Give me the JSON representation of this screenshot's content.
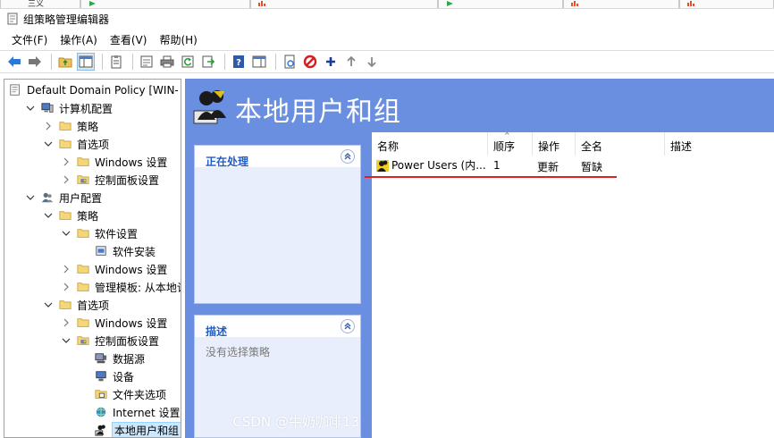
{
  "window": {
    "title": "组策略管理编辑器"
  },
  "tabstrip": {
    "fragment_label": "三义"
  },
  "menu": {
    "items": [
      "文件(F)",
      "操作(A)",
      "查看(V)",
      "帮助(H)"
    ]
  },
  "toolbar": {
    "buttons": [
      "back-icon",
      "forward-icon",
      "up-folder-icon",
      "show-hide-tree-icon",
      "clipboard-icon",
      "properties-icon",
      "print-icon",
      "refresh-icon",
      "export-icon",
      "help-icon",
      "show-hide-action-pane-icon",
      "new-icon",
      "stop-icon",
      "add-icon",
      "move-up-icon",
      "move-down-icon"
    ]
  },
  "tree": {
    "items": [
      {
        "label": "Default Domain Policy [WIN-",
        "depth": 0,
        "expanded": null,
        "icon": "policy-doc-icon"
      },
      {
        "label": "计算机配置",
        "depth": 1,
        "expanded": true,
        "icon": "computer-icon"
      },
      {
        "label": "策略",
        "depth": 2,
        "expanded": false,
        "icon": "folder-icon"
      },
      {
        "label": "首选项",
        "depth": 2,
        "expanded": true,
        "icon": "folder-icon"
      },
      {
        "label": "Windows 设置",
        "depth": 3,
        "expanded": false,
        "icon": "folder-icon"
      },
      {
        "label": "控制面板设置",
        "depth": 3,
        "expanded": false,
        "icon": "control-panel-folder-icon"
      },
      {
        "label": "用户配置",
        "depth": 1,
        "expanded": true,
        "icon": "users-icon"
      },
      {
        "label": "策略",
        "depth": 2,
        "expanded": true,
        "icon": "folder-icon"
      },
      {
        "label": "软件设置",
        "depth": 3,
        "expanded": true,
        "icon": "folder-icon"
      },
      {
        "label": "软件安装",
        "depth": 4,
        "expanded": null,
        "icon": "software-install-icon"
      },
      {
        "label": "Windows 设置",
        "depth": 3,
        "expanded": false,
        "icon": "folder-icon"
      },
      {
        "label": "管理模板: 从本地计算",
        "depth": 3,
        "expanded": false,
        "icon": "folder-icon"
      },
      {
        "label": "首选项",
        "depth": 2,
        "expanded": true,
        "icon": "folder-icon"
      },
      {
        "label": "Windows 设置",
        "depth": 3,
        "expanded": false,
        "icon": "folder-icon"
      },
      {
        "label": "控制面板设置",
        "depth": 3,
        "expanded": true,
        "icon": "control-panel-folder-icon"
      },
      {
        "label": "数据源",
        "depth": 4,
        "expanded": null,
        "icon": "data-source-icon"
      },
      {
        "label": "设备",
        "depth": 4,
        "expanded": null,
        "icon": "device-icon"
      },
      {
        "label": "文件夹选项",
        "depth": 4,
        "expanded": null,
        "icon": "folder-options-icon"
      },
      {
        "label": "Internet 设置",
        "depth": 4,
        "expanded": null,
        "icon": "internet-icon"
      },
      {
        "label": "本地用户和组",
        "depth": 4,
        "expanded": null,
        "icon": "local-users-icon",
        "selected": true
      }
    ]
  },
  "banner": {
    "title": "本地用户和组"
  },
  "tasks": {
    "processing_title": "正在处理",
    "description_title": "描述",
    "description_text": "没有选择策略"
  },
  "list": {
    "columns": [
      "名称",
      "顺序",
      "操作",
      "全名",
      "描述"
    ],
    "rows": [
      {
        "name": "Power Users (内...",
        "order": "1",
        "action": "更新",
        "fullname": "暂缺",
        "description": ""
      }
    ]
  },
  "watermark": "CSDN @牛奶咖啡13",
  "colors": {
    "banner_bg": "#6a8fe0",
    "task_title": "#215dc6",
    "annotation_line": "#e02020",
    "selection_bg": "#cce8ff"
  }
}
